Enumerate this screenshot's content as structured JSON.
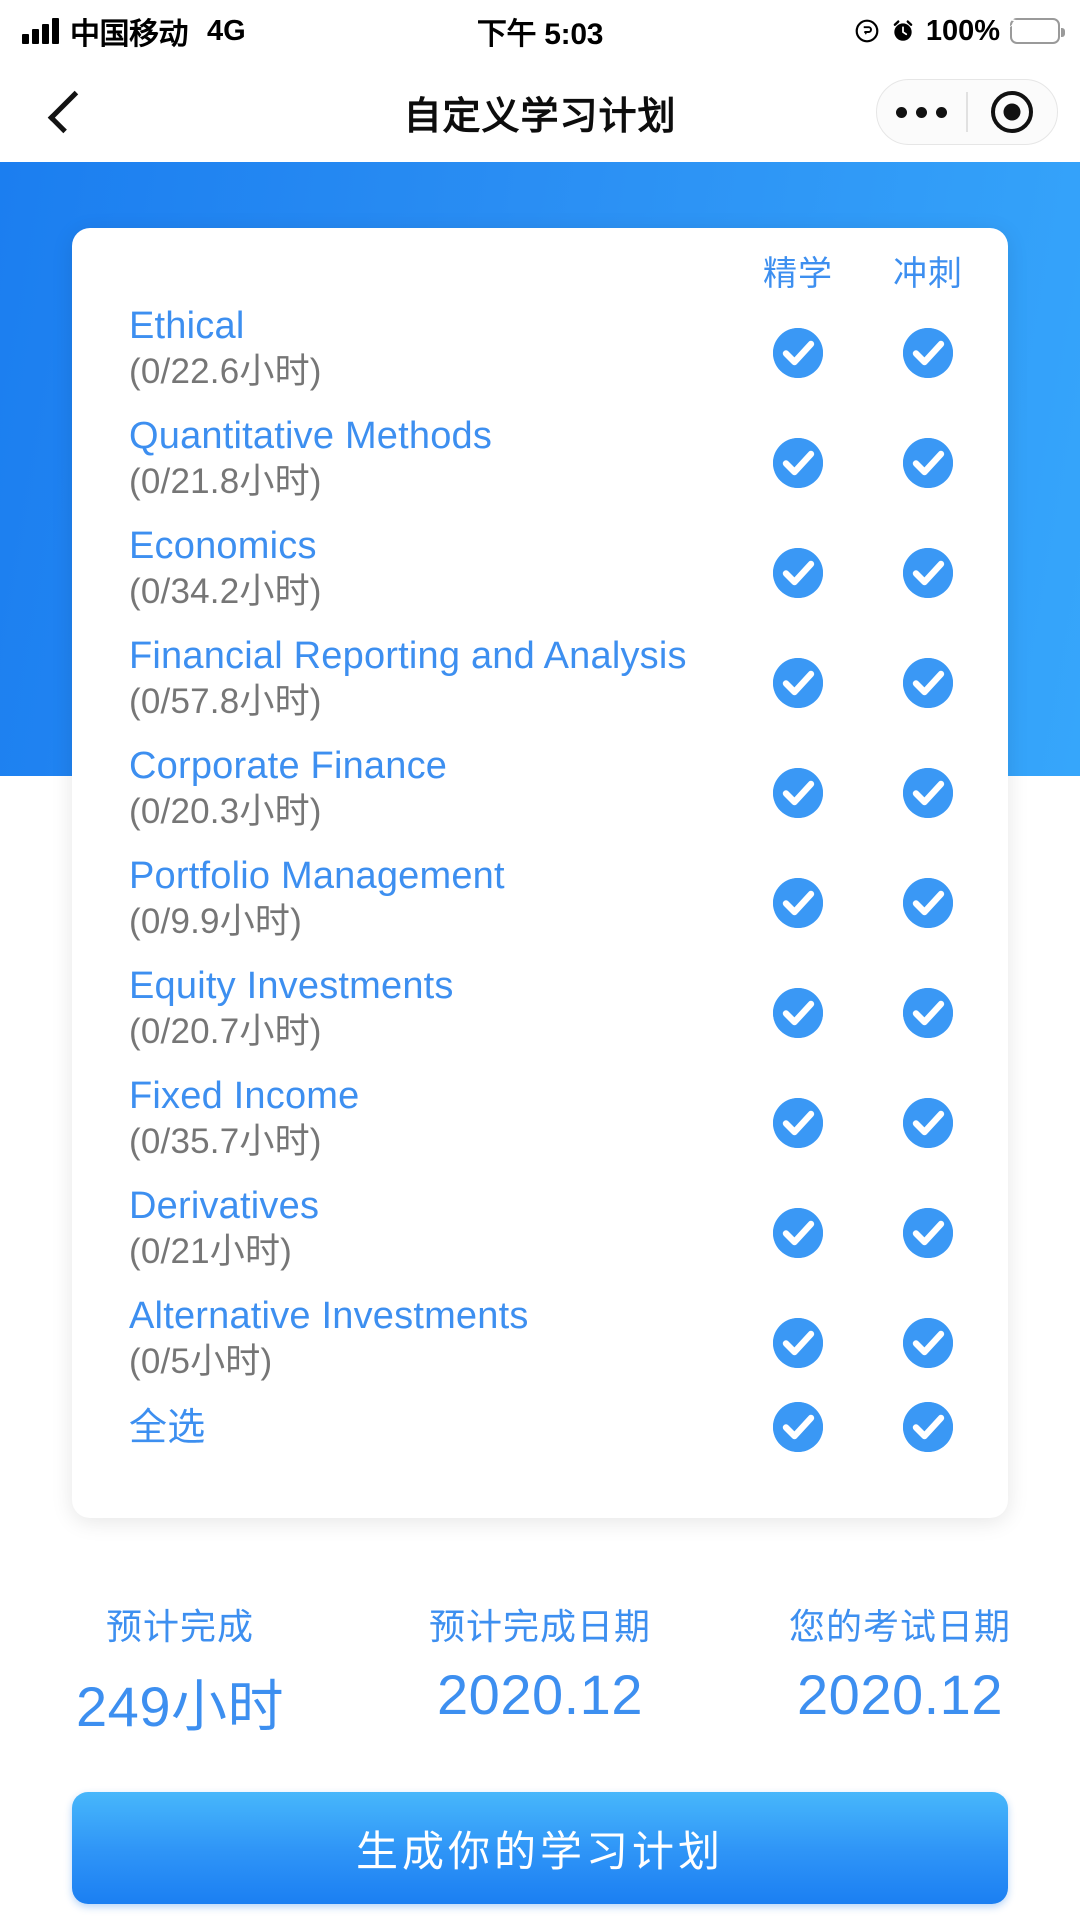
{
  "status_bar": {
    "carrier": "中国移动",
    "network": "4G",
    "time": "下午 5:03",
    "battery_percent": "100%",
    "signal_icon": "signal-bars-icon",
    "lock_icon": "rotation-lock-icon",
    "alarm_icon": "alarm-clock-icon",
    "battery_icon": "battery-charging-icon"
  },
  "navbar": {
    "back_icon": "chevron-left-icon",
    "title": "自定义学习计划",
    "more_icon": "more-options-icon",
    "target_icon": "capsule-target-icon"
  },
  "card": {
    "columns": [
      {
        "label": "精学",
        "key": "intensive"
      },
      {
        "label": "冲刺",
        "key": "sprint"
      }
    ],
    "rows": [
      {
        "subject": "Ethical",
        "hours": "(0/22.6小时)",
        "intensive": true,
        "sprint": true
      },
      {
        "subject": "Quantitative Methods",
        "hours": "(0/21.8小时)",
        "intensive": true,
        "sprint": true
      },
      {
        "subject": "Economics",
        "hours": "(0/34.2小时)",
        "intensive": true,
        "sprint": true
      },
      {
        "subject": "Financial Reporting and Analysis",
        "hours": "(0/57.8小时)",
        "intensive": true,
        "sprint": true
      },
      {
        "subject": "Corporate Finance",
        "hours": "(0/20.3小时)",
        "intensive": true,
        "sprint": true
      },
      {
        "subject": "Portfolio Management",
        "hours": "(0/9.9小时)",
        "intensive": true,
        "sprint": true
      },
      {
        "subject": "Equity Investments",
        "hours": "(0/20.7小时)",
        "intensive": true,
        "sprint": true
      },
      {
        "subject": "Fixed Income",
        "hours": "(0/35.7小时)",
        "intensive": true,
        "sprint": true
      },
      {
        "subject": "Derivatives",
        "hours": "(0/21小时)",
        "intensive": true,
        "sprint": true
      },
      {
        "subject": "Alternative Investments",
        "hours": "(0/5小时)",
        "intensive": true,
        "sprint": true
      }
    ],
    "select_all": {
      "subject": "全选",
      "intensive": true,
      "sprint": true
    }
  },
  "summary": [
    {
      "label": "预计完成",
      "value": "249小时"
    },
    {
      "label": "预计完成日期",
      "value": "2020.12"
    },
    {
      "label": "您的考试日期",
      "value": "2020.12"
    }
  ],
  "cta": {
    "label": "生成你的学习计划"
  },
  "colors": {
    "accent_blue": "#3d8ff0",
    "check_blue": "#3a98f5",
    "hero_blue": "#2a8ef3",
    "hours_gray": "#767676",
    "battery_green": "#34d24b"
  }
}
